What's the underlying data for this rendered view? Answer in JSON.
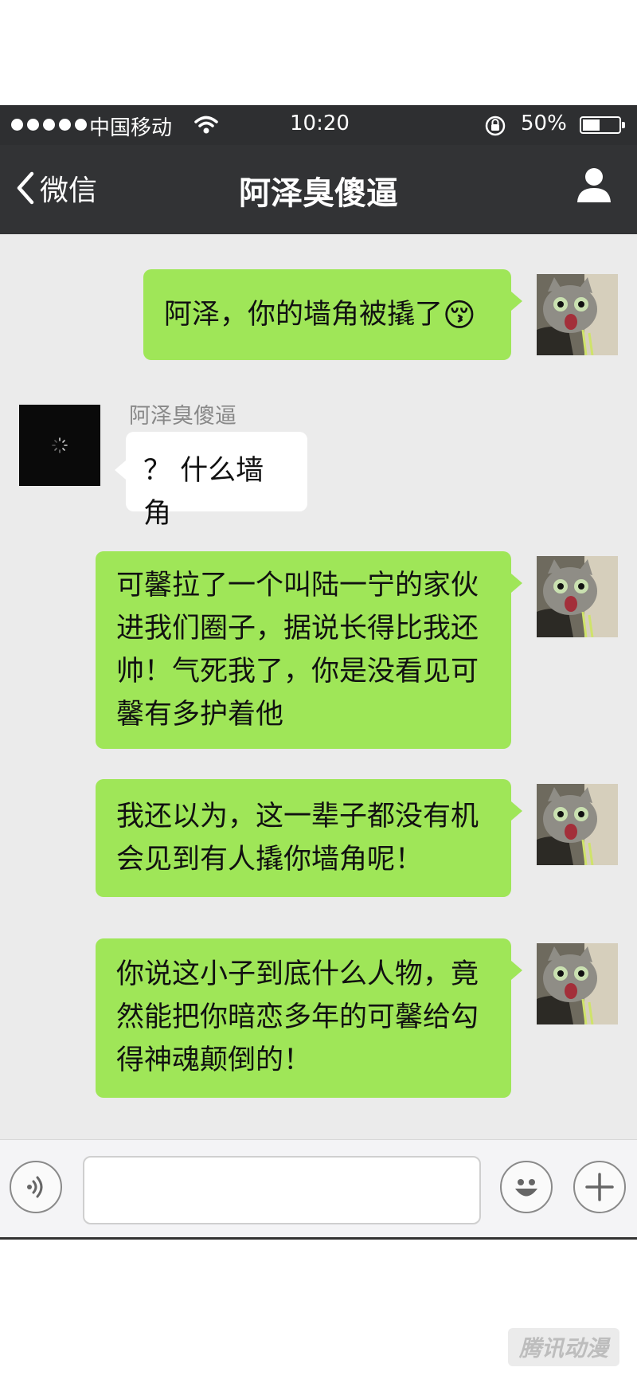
{
  "status_bar": {
    "carrier": "中国移动",
    "time": "10:20",
    "battery_percent": "50%",
    "battery_level": 0.5,
    "icons": [
      "signal-dots-icon",
      "wifi-icon",
      "rotation-lock-icon",
      "battery-icon"
    ]
  },
  "nav": {
    "back_label": "微信",
    "title": "阿泽臭傻逼",
    "back_icon": "chevron-left-icon",
    "profile_icon": "person-icon"
  },
  "messages": [
    {
      "from": "me",
      "text": "阿泽，你的墙角被撬了",
      "emoji": "😚"
    },
    {
      "from": "them",
      "sender": "阿泽臭傻逼",
      "text": "？ 什么墙角"
    },
    {
      "from": "me",
      "text": "可馨拉了一个叫陆一宁的家伙进我们圈子，据说长得比我还帅！气死我了，你是没看见可馨有多护着他"
    },
    {
      "from": "me",
      "text": "我还以为，这一辈子都没有机会见到有人撬你墙角呢！"
    },
    {
      "from": "me",
      "text": "你说这小子到底什么人物，竟然能把你暗恋多年的可馨给勾得神魂颠倒的！"
    }
  ],
  "input_bar": {
    "placeholder": "",
    "voice_icon": "voice-icon",
    "emoji_icon": "smiley-icon",
    "add_icon": "plus-icon"
  },
  "watermark": "腾讯动漫",
  "colors": {
    "bubble_me": "#9fe658",
    "bubble_them": "#ffffff",
    "nav_bg": "#323335",
    "chat_bg": "#ebebeb"
  }
}
